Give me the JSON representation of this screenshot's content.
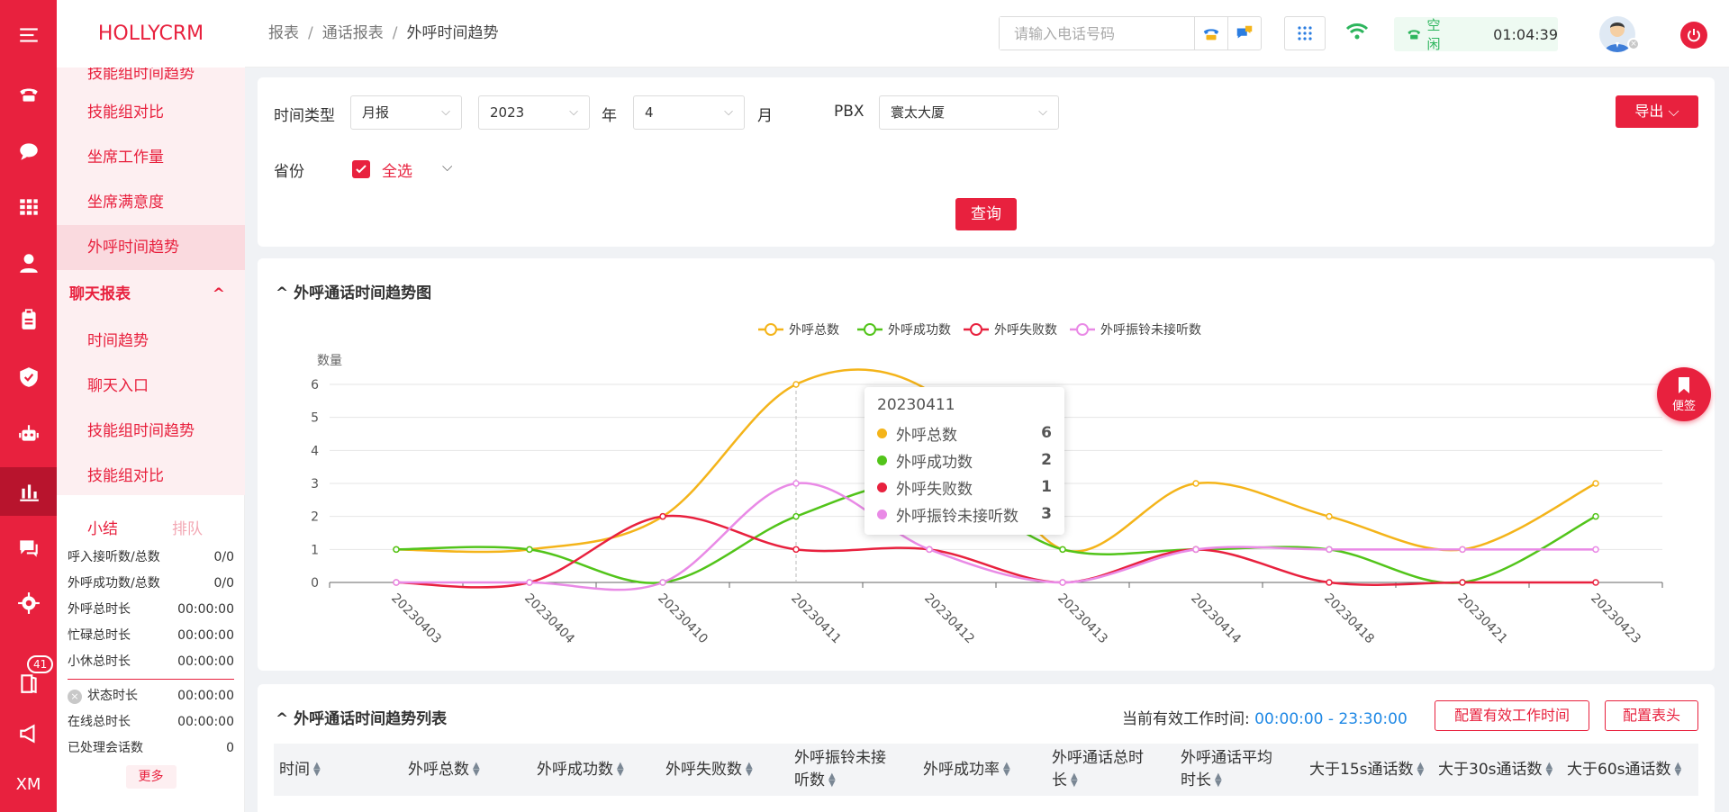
{
  "app": {
    "logo": "HOLLYCRM"
  },
  "rail": {
    "badge": "41",
    "bottom_text": "XM"
  },
  "menu": {
    "items": [
      {
        "label": "技能组时间趋势"
      },
      {
        "label": "技能组对比"
      },
      {
        "label": "坐席工作量"
      },
      {
        "label": "坐席满意度"
      },
      {
        "label": "外呼时间趋势",
        "active": true
      }
    ],
    "group": {
      "label": "聊天报表",
      "arrow": "^"
    },
    "group_items": [
      {
        "label": "时间趋势"
      },
      {
        "label": "聊天入口"
      },
      {
        "label": "技能组时间趋势"
      },
      {
        "label": "技能组对比"
      }
    ]
  },
  "stats": {
    "tab_active": "小结",
    "tab_inactive": "排队",
    "rows": [
      {
        "k": "呼入接听数/总数",
        "v": "0/0"
      },
      {
        "k": "外呼成功数/总数",
        "v": "0/0"
      },
      {
        "k": "外呼总时长",
        "v": "00:00:00"
      },
      {
        "k": "忙碌总时长",
        "v": "00:00:00"
      },
      {
        "k": "小休总时长",
        "v": "00:00:00"
      }
    ],
    "rows2": [
      {
        "k": "状态时长",
        "v": "00:00:00",
        "icon": "×"
      },
      {
        "k": "在线总时长",
        "v": "00:00:00"
      },
      {
        "k": "已处理会话数",
        "v": "0"
      }
    ],
    "more": "更多"
  },
  "header": {
    "breadcrumb": [
      "报表",
      "通话报表",
      "外呼时间趋势"
    ],
    "search_placeholder": "请输入电话号码",
    "status_label": "空闲",
    "status_time": "01:04:39"
  },
  "filter": {
    "time_type_label": "时间类型",
    "time_type": "月报",
    "year": "2023",
    "year_unit": "年",
    "month": "4",
    "month_unit": "月",
    "pbx_label": "PBX",
    "pbx": "寰太大厦",
    "province_label": "省份",
    "select_all": "全选",
    "export": "导出",
    "query": "查询"
  },
  "chart_card": {
    "title": "外呼通话时间趋势图"
  },
  "chart_data": {
    "type": "line",
    "title": "",
    "ylabel": "数量",
    "xlabel": "",
    "ylim": [
      0,
      6
    ],
    "yticks": [
      0,
      1,
      2,
      3,
      4,
      5,
      6
    ],
    "legend_position": "top-center",
    "categories": [
      "20230403",
      "20230404",
      "20230410",
      "20230411",
      "20230412",
      "20230413",
      "20230414",
      "20230418",
      "20230421",
      "20230423"
    ],
    "series": [
      {
        "name": "外呼总数",
        "color": "#f4b41a",
        "values": [
          1,
          1,
          2,
          6,
          5.8,
          1,
          3,
          2,
          1,
          3
        ]
      },
      {
        "name": "外呼成功数",
        "color": "#52c41a",
        "values": [
          1,
          1,
          0,
          2,
          3,
          1,
          1,
          1,
          0,
          2
        ]
      },
      {
        "name": "外呼失败数",
        "color": "#e8213e",
        "values": [
          0,
          0,
          2,
          1,
          1,
          0,
          1,
          0,
          0,
          0
        ]
      },
      {
        "name": "外呼振铃未接听数",
        "color": "#e98ae6",
        "values": [
          0,
          0,
          0,
          3,
          1,
          0,
          1,
          1,
          1,
          1
        ]
      }
    ],
    "tooltip": {
      "title": "20230411",
      "rows": [
        {
          "name": "外呼总数",
          "value": "6",
          "color": "#f4b41a"
        },
        {
          "name": "外呼成功数",
          "value": "2",
          "color": "#52c41a"
        },
        {
          "name": "外呼失败数",
          "value": "1",
          "color": "#e8213e"
        },
        {
          "name": "外呼振铃未接听数",
          "value": "3",
          "color": "#e98ae6"
        }
      ]
    }
  },
  "bookmark": {
    "label": "便签"
  },
  "table": {
    "title": "外呼通话时间趋势列表",
    "worktime_label": "当前有效工作时间:",
    "worktime_value": "00:00:00 - 23:30:00",
    "btn_config_time": "配置有效工作时间",
    "btn_config_header": "配置表头",
    "columns": [
      {
        "l1": "时间",
        "l2": ""
      },
      {
        "l1": "外呼总数",
        "l2": ""
      },
      {
        "l1": "外呼成功数",
        "l2": ""
      },
      {
        "l1": "外呼失败数",
        "l2": ""
      },
      {
        "l1": "外呼振铃未接",
        "l2": "听数"
      },
      {
        "l1": "外呼成功率",
        "l2": ""
      },
      {
        "l1": "外呼通话总时",
        "l2": "长"
      },
      {
        "l1": "外呼通话平均",
        "l2": "时长"
      },
      {
        "l1": "大于15s通话数",
        "l2": ""
      },
      {
        "l1": "大于30s通话数",
        "l2": ""
      },
      {
        "l1": "大于60s通话数",
        "l2": ""
      }
    ]
  },
  "colors": {
    "brand": "#e8213e",
    "status_green": "#2db55d",
    "link_blue": "#1e88e5"
  }
}
